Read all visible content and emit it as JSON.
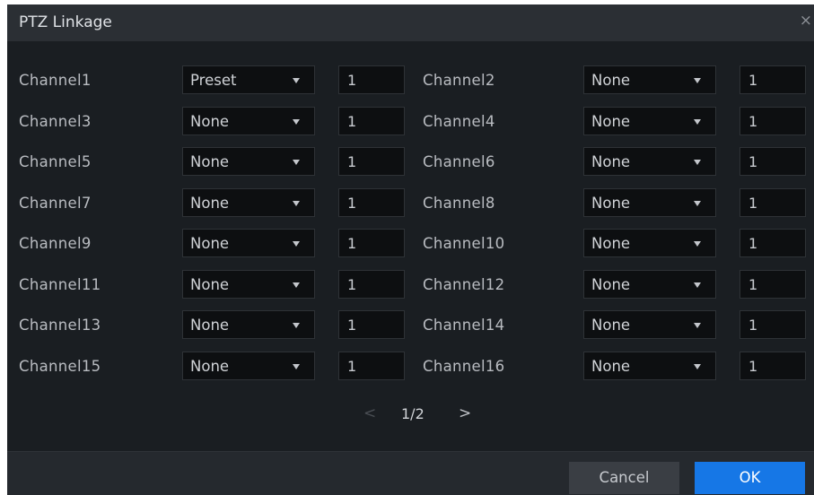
{
  "dialog": {
    "title": "PTZ Linkage",
    "close_glyph": "×"
  },
  "channels": [
    {
      "label": "Channel1",
      "type": "Preset",
      "number": "1"
    },
    {
      "label": "Channel2",
      "type": "None",
      "number": "1"
    },
    {
      "label": "Channel3",
      "type": "None",
      "number": "1"
    },
    {
      "label": "Channel4",
      "type": "None",
      "number": "1"
    },
    {
      "label": "Channel5",
      "type": "None",
      "number": "1"
    },
    {
      "label": "Channel6",
      "type": "None",
      "number": "1"
    },
    {
      "label": "Channel7",
      "type": "None",
      "number": "1"
    },
    {
      "label": "Channel8",
      "type": "None",
      "number": "1"
    },
    {
      "label": "Channel9",
      "type": "None",
      "number": "1"
    },
    {
      "label": "Channel10",
      "type": "None",
      "number": "1"
    },
    {
      "label": "Channel11",
      "type": "None",
      "number": "1"
    },
    {
      "label": "Channel12",
      "type": "None",
      "number": "1"
    },
    {
      "label": "Channel13",
      "type": "None",
      "number": "1"
    },
    {
      "label": "Channel14",
      "type": "None",
      "number": "1"
    },
    {
      "label": "Channel15",
      "type": "None",
      "number": "1"
    },
    {
      "label": "Channel16",
      "type": "None",
      "number": "1"
    }
  ],
  "pager": {
    "prev_glyph": "<",
    "page_text": "1/2",
    "next_glyph": ">"
  },
  "footer": {
    "cancel_label": "Cancel",
    "ok_label": "OK"
  },
  "colors": {
    "background": "#1a1e22",
    "titlebar": "#2b2f34",
    "ok_accent": "#1677e6"
  },
  "icons": {
    "close": "close-icon",
    "dropdown": "caret-down-icon",
    "prev": "chevron-left-icon",
    "next": "chevron-right-icon"
  }
}
